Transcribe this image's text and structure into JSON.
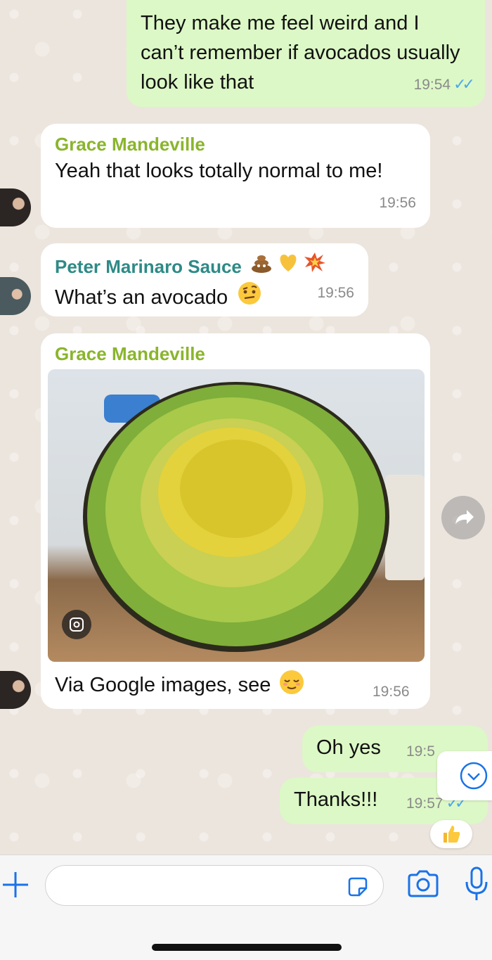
{
  "messages": [
    {
      "text": "They make me feel weird and I can’t remember if avocados usually look like that",
      "time": "19:54",
      "ticks": "✓✓"
    },
    {
      "sender": "Grace Mandeville",
      "text": "Yeah that looks totally normal to me!",
      "time": "19:56"
    },
    {
      "sender": "Peter Marinaro Sauce",
      "text": "What’s an avocado",
      "time": "19:56"
    },
    {
      "sender": "Grace Mandeville",
      "caption": "Via Google images, see",
      "time": "19:56"
    },
    {
      "text": "Oh yes",
      "time": "19:5"
    },
    {
      "text": "Thanks!!!",
      "time": "19:57",
      "ticks": "✓✓"
    }
  ],
  "colors": {
    "outgoing_bubble": "#dcf8c6",
    "incoming_bubble": "#ffffff",
    "sender_grace": "#8ab52c",
    "sender_peter": "#2e8a86",
    "read_ticks": "#4fa8e8",
    "accent": "#1a73e8"
  },
  "icons": [
    "plus-icon",
    "sticker-icon",
    "camera-icon",
    "microphone-icon",
    "forward-icon",
    "scroll-down-icon",
    "thumbs-up-icon",
    "visual-lookup-icon"
  ]
}
